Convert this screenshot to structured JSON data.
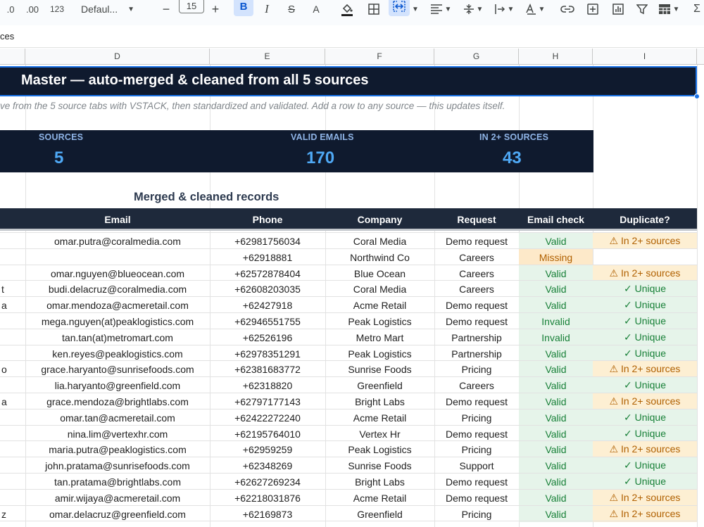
{
  "toolbar": {
    "decimal_less": ".0",
    "decimal_more": ".00",
    "number_format": "123",
    "font_name": "Defaul...",
    "font_size": "15",
    "minus": "−",
    "plus": "+",
    "bold": "B",
    "italic": "I",
    "strike": "S",
    "text_color": "A"
  },
  "formula_bar": {
    "text": "ces"
  },
  "columns": [
    "D",
    "E",
    "F",
    "G",
    "H",
    "I"
  ],
  "banner": {
    "title": "Master — auto-merged & cleaned from all 5 sources"
  },
  "subtitle": "ve from the 5 source tabs with VSTACK, then standardized and validated. Add a row to any source — this updates itself.",
  "stats": [
    {
      "label": "SOURCES",
      "value": "5"
    },
    {
      "label": "VALID EMAILS",
      "value": "170"
    },
    {
      "label": "IN 2+ SOURCES",
      "value": "43"
    }
  ],
  "section_title": "Merged & cleaned records",
  "table_headers": {
    "email": "Email",
    "phone": "Phone",
    "company": "Company",
    "request": "Request",
    "email_check": "Email check",
    "duplicate": "Duplicate?"
  },
  "colors": {
    "valid_bg": "#e6f4ea",
    "valid_text": "#188038",
    "missing_bg": "#fde9c9",
    "missing_text": "#b06000",
    "dup_bg": "#fdefd3",
    "dup_text": "#b06000",
    "unique_bg": "#e6f4ea",
    "unique_text": "#188038"
  },
  "rows": [
    {
      "c": "",
      "email": "omar.putra@coralmedia.com",
      "phone": "+62981756034",
      "company": "Coral Media",
      "request": "Demo request",
      "check": "Valid",
      "dup": "⚠ In 2+ sources"
    },
    {
      "c": "",
      "email": "",
      "phone": "+62918881",
      "company": "Northwind Co",
      "request": "Careers",
      "check": "Missing",
      "dup": ""
    },
    {
      "c": "",
      "email": "omar.nguyen@blueocean.com",
      "phone": "+62572878404",
      "company": "Blue Ocean",
      "request": "Careers",
      "check": "Valid",
      "dup": "⚠ In 2+ sources"
    },
    {
      "c": "t",
      "email": "budi.delacruz@coralmedia.com",
      "phone": "+62608203035",
      "company": "Coral Media",
      "request": "Careers",
      "check": "Valid",
      "dup": "✓ Unique"
    },
    {
      "c": "a",
      "email": "omar.mendoza@acmeretail.com",
      "phone": "+62427918",
      "company": "Acme Retail",
      "request": "Demo request",
      "check": "Valid",
      "dup": "✓ Unique"
    },
    {
      "c": "",
      "email": "mega.nguyen(at)peaklogistics.com",
      "phone": "+62946551755",
      "company": "Peak Logistics",
      "request": "Demo request",
      "check": "Invalid",
      "dup": "✓ Unique"
    },
    {
      "c": "",
      "email": "tan.tan(at)metromart.com",
      "phone": "+62526196",
      "company": "Metro Mart",
      "request": "Partnership",
      "check": "Invalid",
      "dup": "✓ Unique"
    },
    {
      "c": "",
      "email": "ken.reyes@peaklogistics.com",
      "phone": "+62978351291",
      "company": "Peak Logistics",
      "request": "Partnership",
      "check": "Valid",
      "dup": "✓ Unique"
    },
    {
      "c": "o",
      "email": "grace.haryanto@sunrisefoods.com",
      "phone": "+62381683772",
      "company": "Sunrise Foods",
      "request": "Pricing",
      "check": "Valid",
      "dup": "⚠ In 2+ sources"
    },
    {
      "c": "",
      "email": "lia.haryanto@greenfield.com",
      "phone": "+62318820",
      "company": "Greenfield",
      "request": "Careers",
      "check": "Valid",
      "dup": "✓ Unique"
    },
    {
      "c": "a",
      "email": "grace.mendoza@brightlabs.com",
      "phone": "+62797177143",
      "company": "Bright Labs",
      "request": "Demo request",
      "check": "Valid",
      "dup": "⚠ In 2+ sources"
    },
    {
      "c": "",
      "email": "omar.tan@acmeretail.com",
      "phone": "+62422272240",
      "company": "Acme Retail",
      "request": "Pricing",
      "check": "Valid",
      "dup": "✓ Unique"
    },
    {
      "c": "",
      "email": "nina.lim@vertexhr.com",
      "phone": "+62195764010",
      "company": "Vertex Hr",
      "request": "Demo request",
      "check": "Valid",
      "dup": "✓ Unique"
    },
    {
      "c": "",
      "email": "maria.putra@peaklogistics.com",
      "phone": "+62959259",
      "company": "Peak Logistics",
      "request": "Pricing",
      "check": "Valid",
      "dup": "⚠ In 2+ sources"
    },
    {
      "c": "",
      "email": "john.pratama@sunrisefoods.com",
      "phone": "+62348269",
      "company": "Sunrise Foods",
      "request": "Support",
      "check": "Valid",
      "dup": "✓ Unique"
    },
    {
      "c": "",
      "email": "tan.pratama@brightlabs.com",
      "phone": "+62627269234",
      "company": "Bright Labs",
      "request": "Demo request",
      "check": "Valid",
      "dup": "✓ Unique"
    },
    {
      "c": "",
      "email": "amir.wijaya@acmeretail.com",
      "phone": "+62218031876",
      "company": "Acme Retail",
      "request": "Demo request",
      "check": "Valid",
      "dup": "⚠ In 2+ sources"
    },
    {
      "c": "z",
      "email": "omar.delacruz@greenfield.com",
      "phone": "+62169873",
      "company": "Greenfield",
      "request": "Pricing",
      "check": "Valid",
      "dup": "⚠ In 2+ sources"
    }
  ]
}
